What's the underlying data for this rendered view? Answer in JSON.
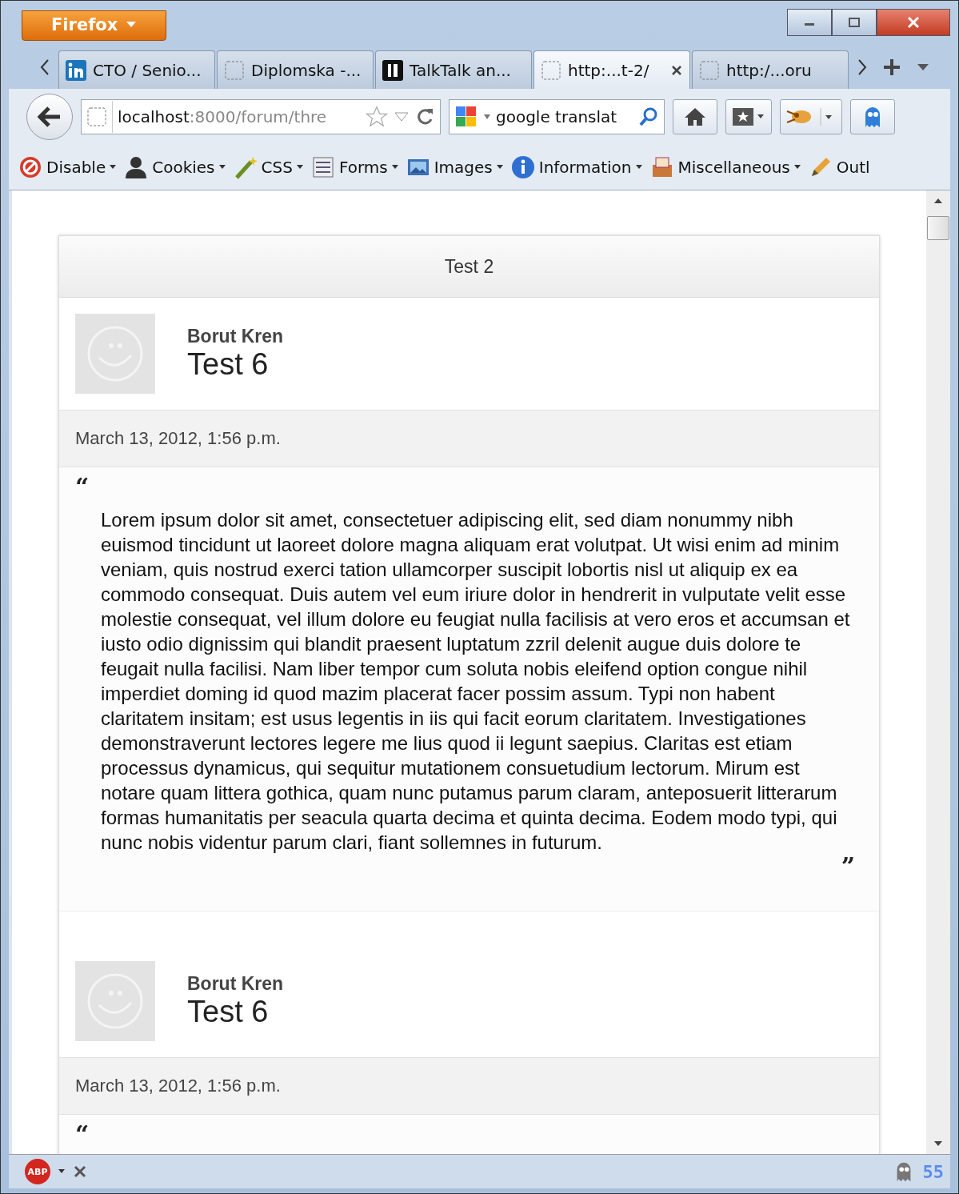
{
  "window": {
    "menu_button": "Firefox"
  },
  "tabs": [
    {
      "label": "CTO / Senio...",
      "selected": false
    },
    {
      "label": "Diplomska -...",
      "selected": false
    },
    {
      "label": "TalkTalk an...",
      "selected": false
    },
    {
      "label": "http:...t-2/",
      "selected": true
    },
    {
      "label": "http:/...oru",
      "selected": false
    }
  ],
  "nav": {
    "url_host": "localhost",
    "url_rest": ":8000/forum/thre",
    "search": "google translat"
  },
  "toolbar": [
    {
      "label": "Disable"
    },
    {
      "label": "Cookies"
    },
    {
      "label": "CSS"
    },
    {
      "label": "Forms"
    },
    {
      "label": "Images"
    },
    {
      "label": "Information"
    },
    {
      "label": "Miscellaneous"
    },
    {
      "label": "Outl"
    }
  ],
  "thread": {
    "title": "Test 2",
    "posts": [
      {
        "author": "Borut Kren",
        "title": "Test 6",
        "date": "March 13, 2012, 1:56 p.m.",
        "open_quote": "“",
        "body": "Lorem ipsum dolor sit amet, consectetuer adipiscing elit, sed diam nonummy nibh euismod tincidunt ut laoreet dolore magna aliquam erat volutpat. Ut wisi enim ad minim veniam, quis nostrud exerci tation ullamcorper suscipit lobortis nisl ut aliquip ex ea commodo consequat. Duis autem vel eum iriure dolor in hendrerit in vulputate velit esse molestie consequat, vel illum dolore eu feugiat nulla facilisis at vero eros et accumsan et iusto odio dignissim qui blandit praesent luptatum zzril delenit augue duis dolore te feugait nulla facilisi. Nam liber tempor cum soluta nobis eleifend option congue nihil imperdiet doming id quod mazim placerat facer possim assum. Typi non habent claritatem insitam; est usus legentis in iis qui facit eorum claritatem. Investigationes demonstraverunt lectores legere me lius quod ii legunt saepius. Claritas est etiam processus dynamicus, qui sequitur mutationem consuetudium lectorum. Mirum est notare quam littera gothica, quam nunc putamus parum claram, anteposuerit litterarum formas humanitatis per seacula quarta decima et quinta decima. Eodem modo typi, qui nunc nobis videntur parum clari, fiant sollemnes in futurum.",
        "close_quote": "”"
      },
      {
        "author": "Borut Kren",
        "title": "Test 6",
        "date": "March 13, 2012, 1:56 p.m.",
        "open_quote": "“"
      }
    ]
  },
  "status_bar": {
    "adblock": "ABP",
    "right_text": "55"
  }
}
